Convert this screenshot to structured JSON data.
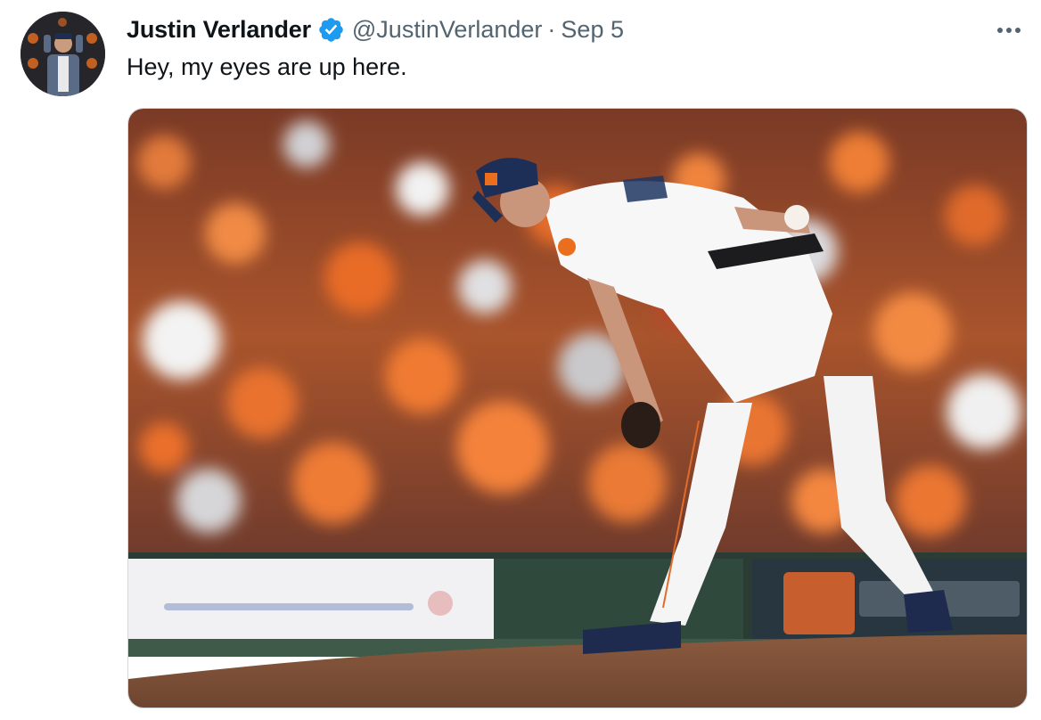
{
  "tweet": {
    "author": {
      "display_name": "Justin Verlander",
      "handle": "@JustinVerlander",
      "verified": true,
      "avatar_icon": "profile-photo"
    },
    "separator": "·",
    "date": "Sep 5",
    "text": "Hey, my eyes are up here.",
    "more_icon": "more-horizontal-icon",
    "media": {
      "type": "photo"
    }
  },
  "colors": {
    "verified": "#1d9bf0",
    "secondary_text": "#536471",
    "astros_orange": "#eb6e1f",
    "astros_navy": "#002d62"
  }
}
